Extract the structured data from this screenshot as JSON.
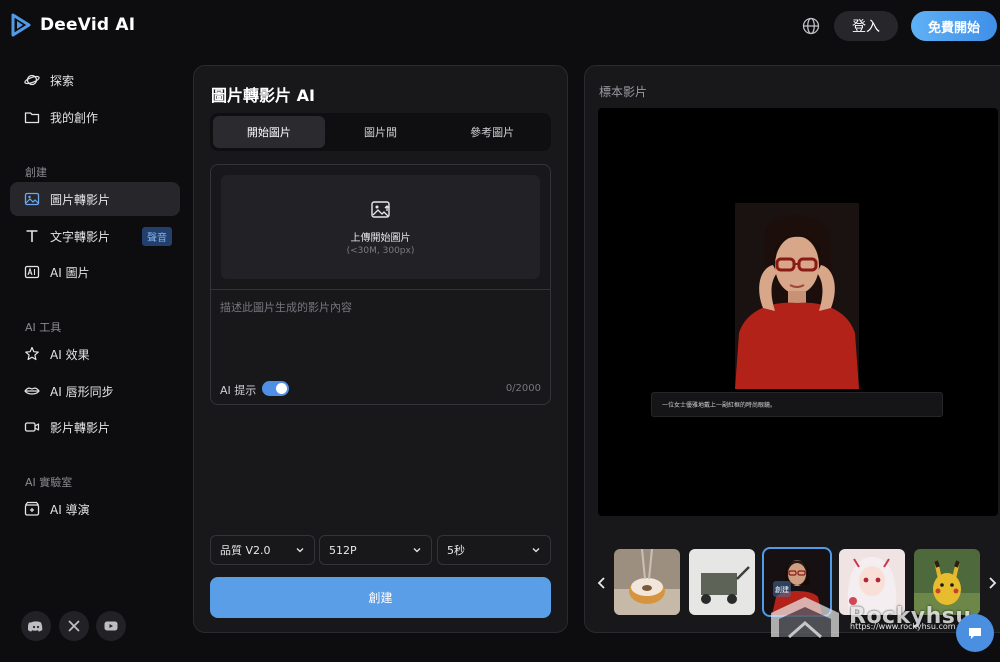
{
  "header": {
    "logo_text": "DeeVid AI",
    "login_label": "登入",
    "start_label": "免費開始"
  },
  "sidebar": {
    "items": [
      {
        "label": "探索",
        "icon": "planet-icon"
      },
      {
        "label": "我的創作",
        "icon": "folder-icon"
      }
    ],
    "create_section": "創建",
    "create_items": [
      {
        "label": "圖片轉影片",
        "icon": "image-icon",
        "active": true
      },
      {
        "label": "文字轉影片",
        "icon": "text-icon",
        "badge": "聲音"
      },
      {
        "label": "AI 圖片",
        "icon": "ai-image-icon"
      }
    ],
    "tools_section": "AI 工具",
    "tools_items": [
      {
        "label": "AI 效果",
        "icon": "sparkle-icon"
      },
      {
        "label": "AI 唇形同步",
        "icon": "lips-icon"
      },
      {
        "label": "影片轉影片",
        "icon": "video-icon"
      }
    ],
    "lab_section": "AI 實驗室",
    "lab_items": [
      {
        "label": "AI 導演",
        "icon": "director-icon"
      }
    ],
    "social": [
      "discord-icon",
      "x-icon",
      "youtube-icon"
    ]
  },
  "main": {
    "title": "圖片轉影片 AI",
    "tabs": [
      {
        "label": "開始圖片",
        "active": true
      },
      {
        "label": "圖片間"
      },
      {
        "label": "參考圖片"
      }
    ],
    "upload_label": "上傳開始圖片",
    "upload_hint": "(<30M, 300px)",
    "prompt_placeholder": "描述此圖片生成的影片內容",
    "ai_prompt_label": "AI 提示",
    "ai_prompt_enabled": true,
    "char_counter": "0/2000",
    "quality": "品質 V2.0",
    "resolution": "512P",
    "duration": "5秒",
    "create_label": "創建"
  },
  "sample": {
    "title": "標本影片",
    "caption": "一位女士優雅地戴上一副紅框的時尚眼鏡。",
    "thumb_overlay": "創建",
    "thumbnails": [
      "donut",
      "wagon",
      "woman-glasses",
      "anime-girl",
      "pikachu"
    ],
    "active_thumb": 2
  },
  "watermark": {
    "text": "Rockyhsu",
    "url": "https://www.rockyhsu.com"
  },
  "colors": {
    "accent": "#4f9be8",
    "button": "#5b9ee8",
    "background": "#0d0d0f",
    "panel": "#18181b"
  }
}
